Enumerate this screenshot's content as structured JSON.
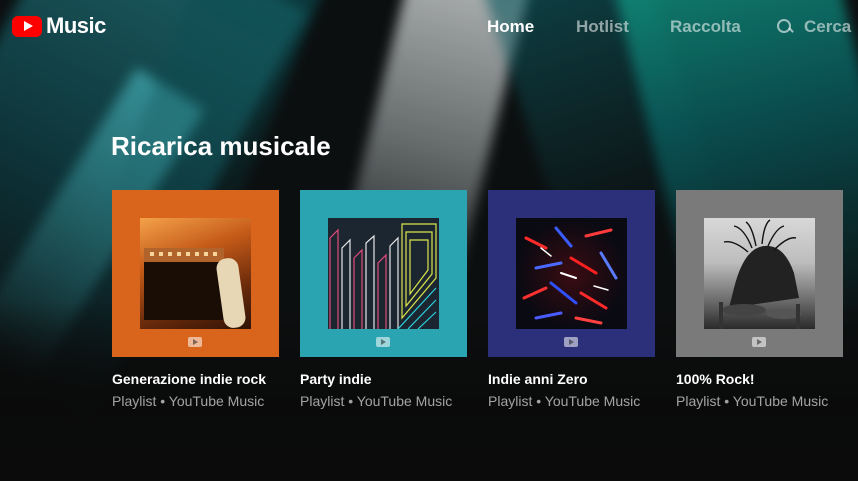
{
  "app": {
    "logo_text": "Music",
    "brand_color": "#ff0000"
  },
  "nav": {
    "items": [
      {
        "label": "Home",
        "active": true
      },
      {
        "label": "Hotlist",
        "active": false
      },
      {
        "label": "Raccolta",
        "active": false
      }
    ],
    "search_label": "Cerca",
    "search_icon": "search-icon"
  },
  "section": {
    "title": "Ricarica musicale",
    "cards": [
      {
        "title": "Generazione indie rock",
        "subtitle": "Playlist • YouTube Music",
        "tile_color": "#d9651c"
      },
      {
        "title": "Party indie",
        "subtitle": "Playlist • YouTube Music",
        "tile_color": "#2ba4b2"
      },
      {
        "title": "Indie anni Zero",
        "subtitle": "Playlist • YouTube Music",
        "tile_color": "#2c2f7a"
      },
      {
        "title": "100% Rock!",
        "subtitle": "Playlist • YouTube Music",
        "tile_color": "#7a7a7a"
      }
    ]
  }
}
